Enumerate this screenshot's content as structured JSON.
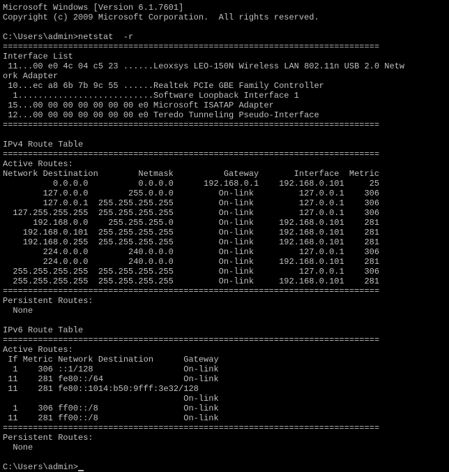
{
  "output": "Microsoft Windows [Version 6.1.7601]\nCopyright (c) 2009 Microsoft Corporation.  All rights reserved.\n\nC:\\Users\\admin>netstat  -r\n===========================================================================\nInterface List\n 11...00 e0 4c 04 c5 23 ......Leoxsys LEO-150N Wireless LAN 802.11n USB 2.0 Netw\nork Adapter\n 10...ec a8 6b 7b 9c 55 ......Realtek PCIe GBE Family Controller\n  1...........................Software Loopback Interface 1\n 15...00 00 00 00 00 00 00 e0 Microsoft ISATAP Adapter\n 12...00 00 00 00 00 00 00 e0 Teredo Tunneling Pseudo-Interface\n===========================================================================\n\nIPv4 Route Table\n===========================================================================\nActive Routes:\nNetwork Destination        Netmask          Gateway       Interface  Metric\n          0.0.0.0          0.0.0.0      192.168.0.1    192.168.0.101     25\n        127.0.0.0        255.0.0.0         On-link         127.0.0.1    306\n        127.0.0.1  255.255.255.255         On-link         127.0.0.1    306\n  127.255.255.255  255.255.255.255         On-link         127.0.0.1    306\n      192.168.0.0    255.255.255.0         On-link     192.168.0.101    281\n    192.168.0.101  255.255.255.255         On-link     192.168.0.101    281\n    192.168.0.255  255.255.255.255         On-link     192.168.0.101    281\n        224.0.0.0        240.0.0.0         On-link         127.0.0.1    306\n        224.0.0.0        240.0.0.0         On-link     192.168.0.101    281\n  255.255.255.255  255.255.255.255         On-link         127.0.0.1    306\n  255.255.255.255  255.255.255.255         On-link     192.168.0.101    281\n===========================================================================\nPersistent Routes:\n  None\n\nIPv6 Route Table\n===========================================================================\nActive Routes:\n If Metric Network Destination      Gateway\n  1    306 ::1/128                  On-link\n 11    281 fe80::/64                On-link\n 11    281 fe80::1014:b50:9fff:3e32/128\n                                    On-link\n  1    306 ff00::/8                 On-link\n 11    281 ff00::/8                 On-link\n===========================================================================\nPersistent Routes:\n  None\n\n",
  "prompt": "C:\\Users\\admin>",
  "chart_data": {
    "type": "table",
    "title": "IPv4 Route Table - Active Routes",
    "columns": [
      "Network Destination",
      "Netmask",
      "Gateway",
      "Interface",
      "Metric"
    ],
    "rows": [
      [
        "0.0.0.0",
        "0.0.0.0",
        "192.168.0.1",
        "192.168.0.101",
        25
      ],
      [
        "127.0.0.0",
        "255.0.0.0",
        "On-link",
        "127.0.0.1",
        306
      ],
      [
        "127.0.0.1",
        "255.255.255.255",
        "On-link",
        "127.0.0.1",
        306
      ],
      [
        "127.255.255.255",
        "255.255.255.255",
        "On-link",
        "127.0.0.1",
        306
      ],
      [
        "192.168.0.0",
        "255.255.255.0",
        "On-link",
        "192.168.0.101",
        281
      ],
      [
        "192.168.0.101",
        "255.255.255.255",
        "On-link",
        "192.168.0.101",
        281
      ],
      [
        "192.168.0.255",
        "255.255.255.255",
        "On-link",
        "192.168.0.101",
        281
      ],
      [
        "224.0.0.0",
        "240.0.0.0",
        "On-link",
        "127.0.0.1",
        306
      ],
      [
        "224.0.0.0",
        "240.0.0.0",
        "On-link",
        "192.168.0.101",
        281
      ],
      [
        "255.255.255.255",
        "255.255.255.255",
        "On-link",
        "127.0.0.1",
        306
      ],
      [
        "255.255.255.255",
        "255.255.255.255",
        "On-link",
        "192.168.0.101",
        281
      ]
    ]
  },
  "interfaces": [
    {
      "if": 11,
      "mac": "00 e0 4c 04 c5 23",
      "name": "Leoxsys LEO-150N Wireless LAN 802.11n USB 2.0 Network Adapter"
    },
    {
      "if": 10,
      "mac": "ec a8 6b 7b 9c 55",
      "name": "Realtek PCIe GBE Family Controller"
    },
    {
      "if": 1,
      "mac": "",
      "name": "Software Loopback Interface 1"
    },
    {
      "if": 15,
      "mac": "00 00 00 00 00 00 00 e0",
      "name": "Microsoft ISATAP Adapter"
    },
    {
      "if": 12,
      "mac": "00 00 00 00 00 00 00 e0",
      "name": "Teredo Tunneling Pseudo-Interface"
    }
  ],
  "ipv6_routes": [
    {
      "if": 1,
      "metric": 306,
      "dest": "::1/128",
      "gateway": "On-link"
    },
    {
      "if": 11,
      "metric": 281,
      "dest": "fe80::/64",
      "gateway": "On-link"
    },
    {
      "if": 11,
      "metric": 281,
      "dest": "fe80::1014:b50:9fff:3e32/128",
      "gateway": "On-link"
    },
    {
      "if": 1,
      "metric": 306,
      "dest": "ff00::/8",
      "gateway": "On-link"
    },
    {
      "if": 11,
      "metric": 281,
      "dest": "ff00::/8",
      "gateway": "On-link"
    }
  ],
  "persistent_routes_ipv4": "None",
  "persistent_routes_ipv6": "None",
  "command": "netstat  -r",
  "os_version": "Microsoft Windows [Version 6.1.7601]",
  "copyright": "Copyright (c) 2009 Microsoft Corporation.  All rights reserved."
}
